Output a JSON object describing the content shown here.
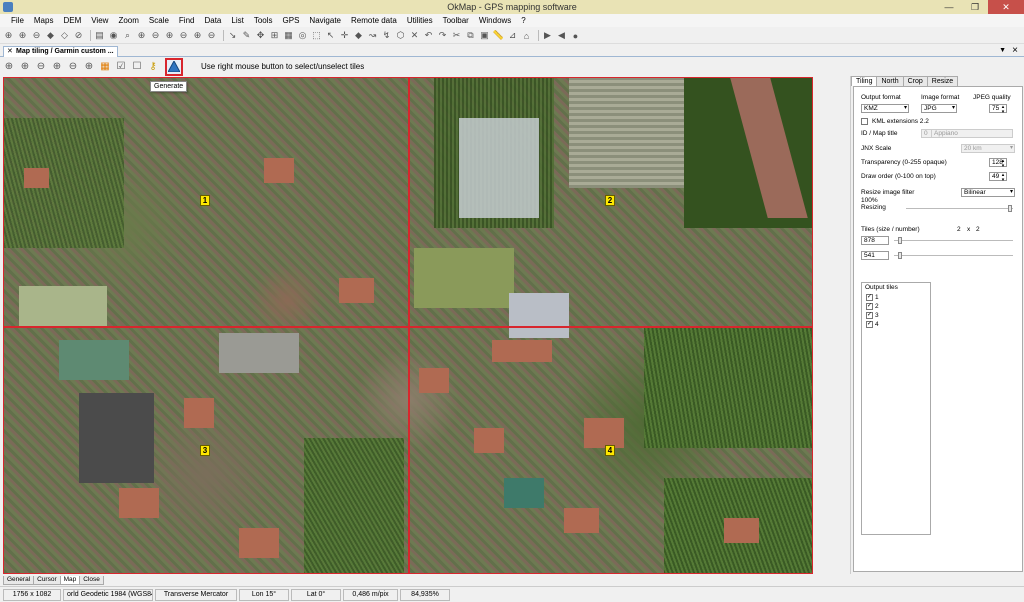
{
  "window": {
    "title": "OkMap - GPS mapping software",
    "controls": [
      "—",
      "❐",
      "✕"
    ]
  },
  "menu": [
    "File",
    "Maps",
    "DEM",
    "View",
    "Zoom",
    "Scale",
    "Find",
    "Data",
    "List",
    "Tools",
    "GPS",
    "Navigate",
    "Remote data",
    "Utilities",
    "Toolbar",
    "Windows",
    "?"
  ],
  "doc_tab": {
    "title": "Map tiling / Garmin custom ...",
    "close": "×"
  },
  "tiling_toolbar": {
    "hint": "Use right mouse button to select/unselect tiles",
    "tooltip": "Generate"
  },
  "map": {
    "tiles": [
      "1",
      "2",
      "3",
      "4"
    ]
  },
  "panel": {
    "tabs": [
      "Tiling",
      "North",
      "Crop",
      "Resize"
    ],
    "active_tab": "Tiling",
    "output_format_label": "Output format",
    "output_format": "KMZ",
    "image_format_label": "Image format",
    "image_format": "JPG",
    "jpeg_quality_label": "JPEG quality",
    "jpeg_quality": "75",
    "kml_ext_label": "KML extensions 2.2",
    "id_title_label": "ID / Map title",
    "id_value": "0",
    "map_title": "Appiano",
    "jnx_scale_label": "JNX Scale",
    "jnx_scale": "20 km",
    "transparency_label": "Transparency (0-255 opaque)",
    "transparency": "128",
    "draw_order_label": "Draw order (0-100 on top)",
    "draw_order": "49",
    "resize_filter_label": "Resize image filter",
    "resize_filter": "Bilinear",
    "resizing_pct": "100%",
    "resizing_label": "Resizing",
    "resizing_level": 1.0,
    "tiles_label": "Tiles (size / number)",
    "tiles_x": "2",
    "tiles_times": "x",
    "tiles_y": "2",
    "tile_width": "878",
    "tile_height": "541",
    "output_tiles_label": "Output tiles",
    "output_tiles": [
      {
        "label": "1",
        "checked": true
      },
      {
        "label": "2",
        "checked": true
      },
      {
        "label": "3",
        "checked": true
      },
      {
        "label": "4",
        "checked": true
      }
    ]
  },
  "bottom_tabs": [
    "General",
    "Cursor",
    "Map",
    "Close"
  ],
  "active_bottom_tab": "Map",
  "status": {
    "size": "1756 x 1082",
    "datum": "orld Geodetic 1984 (WGS84",
    "projection": "Transverse Mercator",
    "lon": "Lon 15°",
    "lat": "Lat 0°",
    "resolution": "0,486 m/pix",
    "zoom": "84,935%"
  },
  "colors": {
    "grid": "#d8262d",
    "label_bg": "#ffe800",
    "titlebar": "#e9e3b5"
  }
}
